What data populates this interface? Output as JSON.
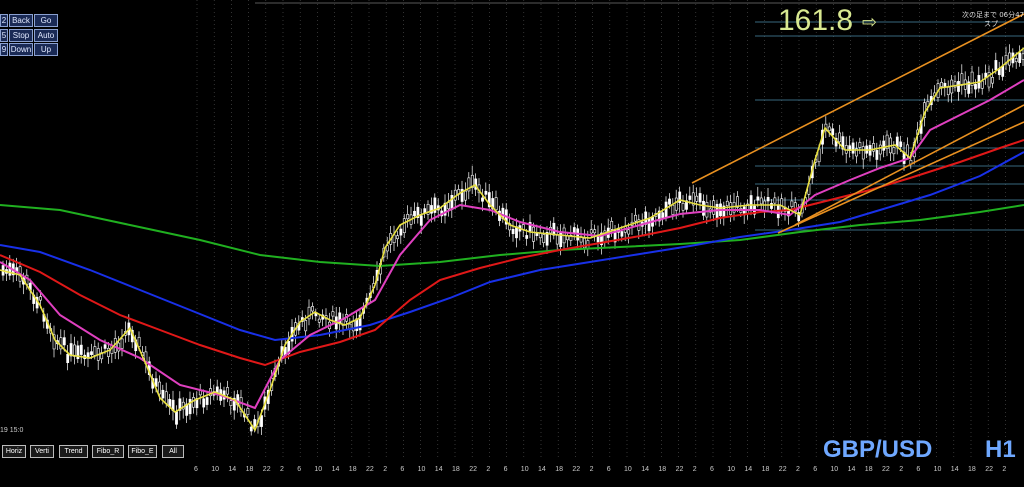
{
  "nav_buttons": {
    "back": "Back",
    "go": "Go",
    "stop": "Stop",
    "auto": "Auto",
    "down": "Down",
    "up": "Up",
    "side_1": "2",
    "side_2": "5",
    "side_3": "9"
  },
  "tool_buttons": [
    "Horiz",
    "Verti",
    "Trend",
    "Fibo_R",
    "Fibo_E",
    "All"
  ],
  "fib_level_text": "161.8",
  "fib_arrow": "⇨",
  "japanese_text_1": "次の足まで 06分47",
  "japanese_text_2": "スプ",
  "time_label": "19 15:0",
  "symbol": "GBP/USD",
  "timeframe": "H1",
  "x_axis_ticks": [
    "6",
    "10",
    "14",
    "18",
    "22",
    "2",
    "6",
    "10",
    "14",
    "18",
    "22",
    "2",
    "6",
    "10",
    "14",
    "18",
    "22",
    "2",
    "6",
    "10",
    "14",
    "18",
    "22",
    "2",
    "6",
    "10",
    "14",
    "18",
    "22",
    "2",
    "6",
    "10",
    "14",
    "18",
    "22",
    "2",
    "6",
    "10",
    "14",
    "18",
    "22",
    "2",
    "6",
    "10",
    "14",
    "18",
    "22",
    "2",
    "6",
    "10",
    "14",
    "18",
    "22"
  ],
  "colors": {
    "background": "#000000",
    "ma_yellow": "#e8e040",
    "ma_magenta": "#e040c0",
    "ma_red": "#e01818",
    "ma_blue": "#1830e8",
    "ma_green": "#20b020",
    "channel_orange": "#e89020",
    "fib_lines": "#4a8aa8",
    "candles": "#ffffff",
    "symbol_text": "#6fa8ff"
  }
}
